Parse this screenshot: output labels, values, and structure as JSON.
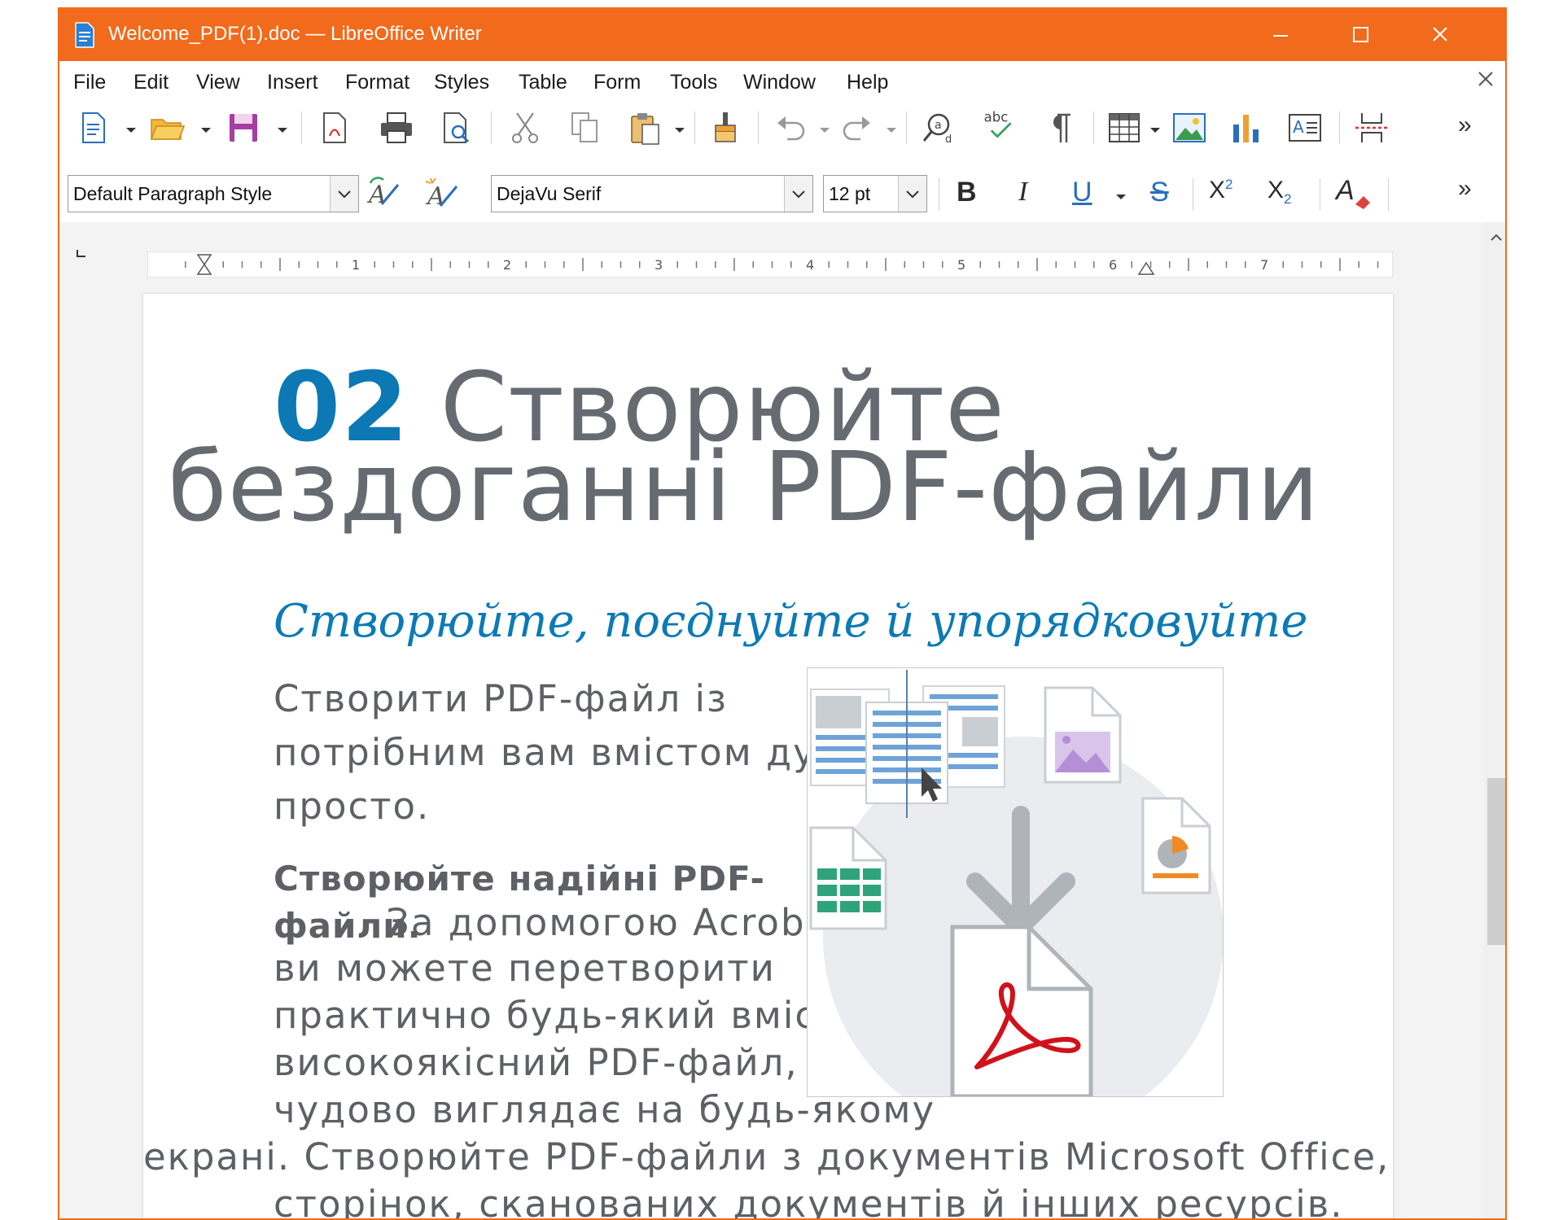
{
  "window": {
    "title": "Welcome_PDF(1).doc — LibreOffice Writer",
    "titlebar_color": "#f26a1b"
  },
  "menubar": {
    "items": [
      {
        "label": "File"
      },
      {
        "label": "Edit"
      },
      {
        "label": "View"
      },
      {
        "label": "Insert"
      },
      {
        "label": "Format"
      },
      {
        "label": "Styles"
      },
      {
        "label": "Table"
      },
      {
        "label": "Form"
      },
      {
        "label": "Tools"
      },
      {
        "label": "Window"
      },
      {
        "label": "Help"
      }
    ]
  },
  "toolbar_standard": {
    "icons": [
      "new-document-icon",
      "open-folder-icon",
      "save-icon",
      "export-pdf-icon",
      "print-icon",
      "print-preview-icon",
      "cut-icon",
      "copy-icon",
      "paste-icon",
      "clone-formatting-icon",
      "undo-icon",
      "redo-icon",
      "find-replace-icon",
      "spellcheck-icon",
      "formatting-marks-icon",
      "insert-table-icon",
      "insert-image-icon",
      "insert-chart-icon",
      "insert-textbox-icon",
      "page-break-icon"
    ],
    "spellcheck_label": "abc"
  },
  "toolbar_formatting": {
    "paragraph_style": "Default Paragraph Style",
    "font_name": "DejaVu Serif",
    "font_size": "12 pt",
    "bold_label": "B",
    "italic_label": "I",
    "underline_label": "U",
    "strike_label": "S",
    "superscript_label": "X",
    "superscript_exp": "2",
    "subscript_label": "X",
    "subscript_exp": "2",
    "font_color_label": "A"
  },
  "ruler": {
    "numbers": [
      "1",
      "2",
      "3",
      "4",
      "5",
      "6",
      "7"
    ]
  },
  "document": {
    "heading_number": "02",
    "heading_line1": "Створюйте",
    "heading_line2": "бездоганні PDF-файли",
    "subtitle": "Створюйте, поєднуйте й упорядковуйте",
    "para1": [
      "Створити PDF-файл із",
      "потрібним вам вмістом ду",
      "просто."
    ],
    "para2_bold": [
      "Створюйте надійні PDF-",
      "файли."
    ],
    "para2_overlap": "За допомогою Acrobat",
    "para2_lines": [
      "ви можете перетворити",
      "практично будь-який вміст на",
      "високоякісний PDF-файл, що",
      "чудово виглядає на будь-якому"
    ],
    "para2_wide": "екрані. Створюйте PDF-файли з документів Microsoft Office, веб-",
    "para2_last": "сторінок, сканованих документів й інших ресурсів.",
    "colors": {
      "heading_number": "#0c78b4",
      "heading_text": "#666b71",
      "subtitle": "#0b7ab5",
      "body": "#5d6166"
    }
  }
}
